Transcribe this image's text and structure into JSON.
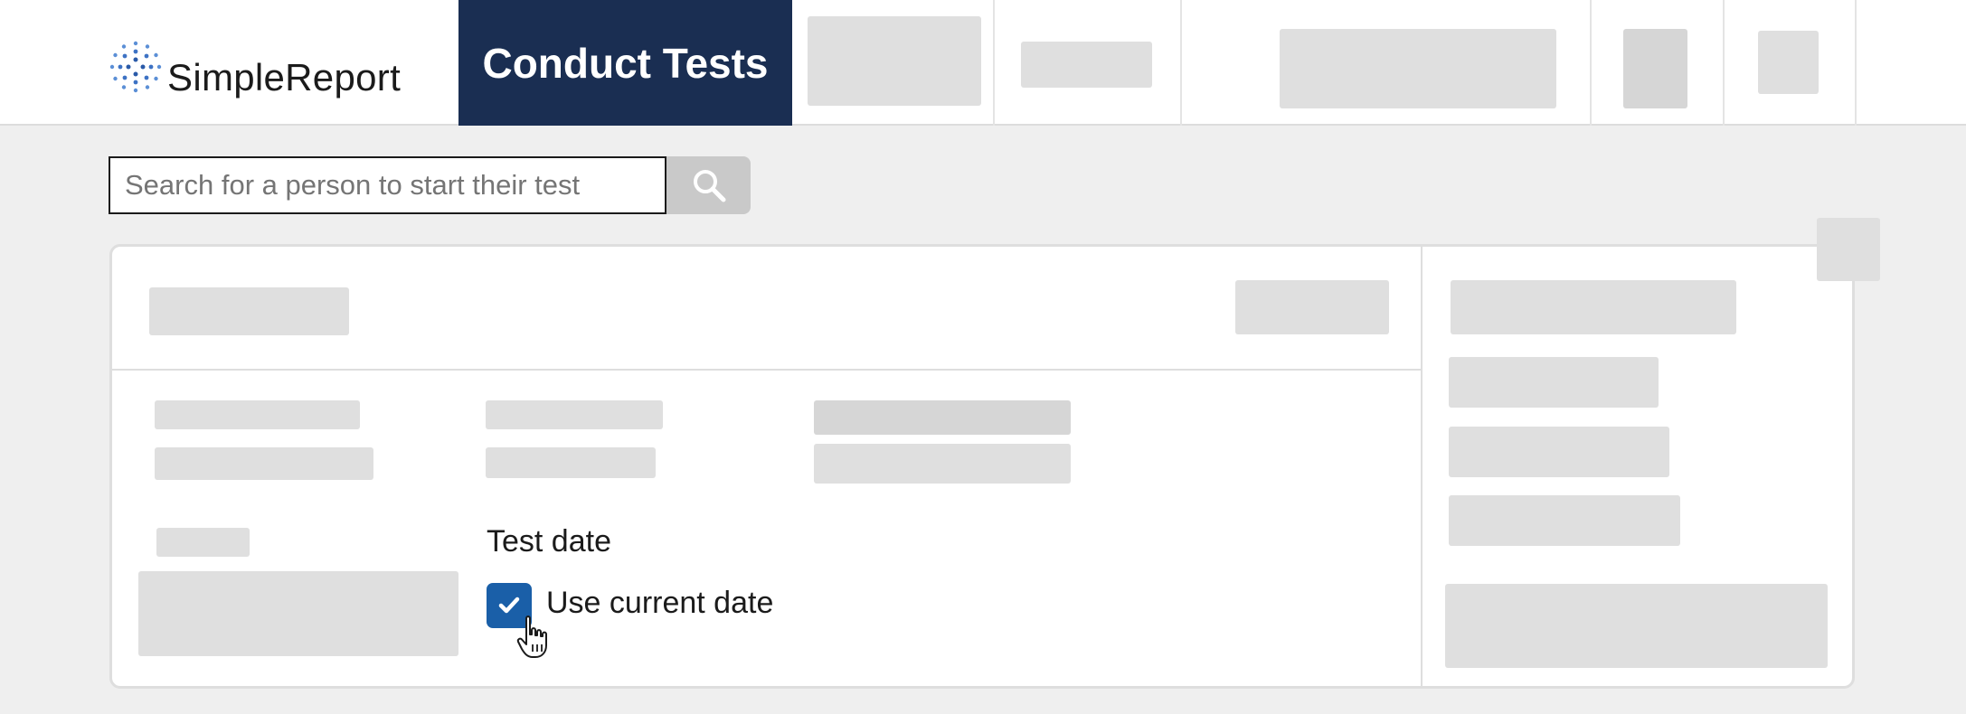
{
  "header": {
    "logo_text": "SimpleReport",
    "active_tab": "Conduct Tests"
  },
  "search": {
    "placeholder": "Search for a person to start their test",
    "value": ""
  },
  "test_card": {
    "test_date_label": "Test date",
    "use_current_date_label": "Use current date",
    "use_current_date_checked": true
  },
  "colors": {
    "nav_active_bg": "#1a2e52",
    "checkbox_bg": "#1a5fa8",
    "page_bg": "#efefef"
  },
  "icons": {
    "search": "search-icon",
    "check": "checkmark-icon",
    "logo": "simplereport-logo-icon",
    "cursor": "hand-pointer-cursor-icon"
  }
}
